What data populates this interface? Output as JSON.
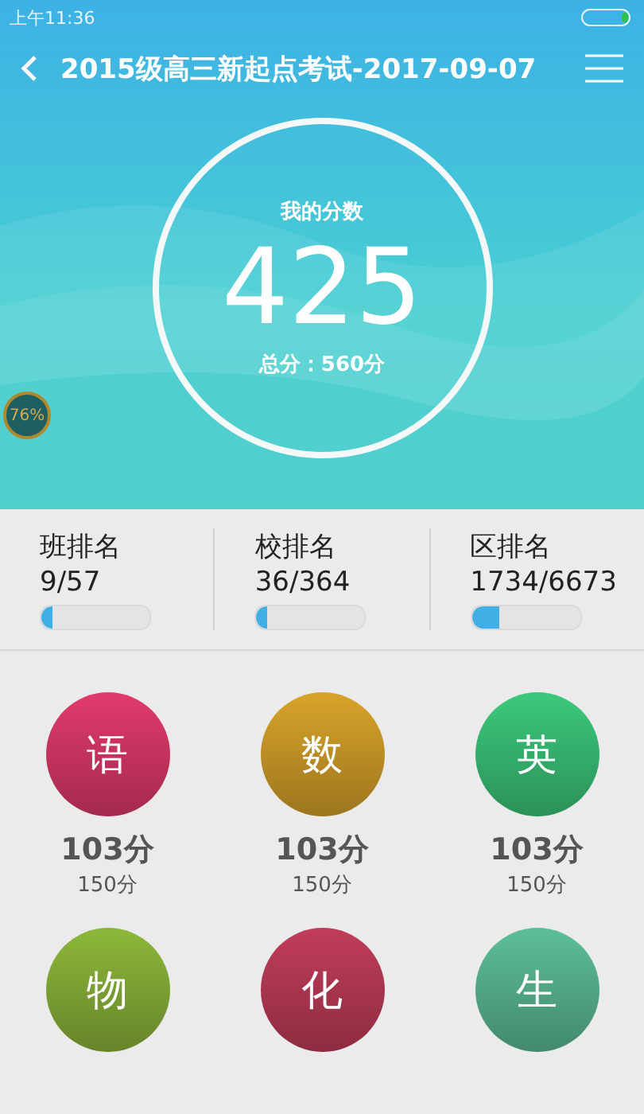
{
  "status_bar": {
    "time": "上午11:36"
  },
  "header": {
    "title": "2015级高三新起点考试-2017-09-07"
  },
  "score": {
    "label": "我的分数",
    "value": "425",
    "total": "总分：560分"
  },
  "badge": {
    "text": "76%"
  },
  "rankings": [
    {
      "label": "班排名",
      "value": "9/57",
      "level": 0.1
    },
    {
      "label": "校排名",
      "value": "36/364",
      "level": 0.1
    },
    {
      "label": "区排名",
      "value": "1734/6673",
      "level": 0.26
    }
  ],
  "subjects": [
    {
      "name": "语",
      "color": "#e23a6c",
      "score": "103分",
      "full": "150分"
    },
    {
      "name": "数",
      "color": "#d8a42a",
      "score": "103分",
      "full": "150分"
    },
    {
      "name": "英",
      "color": "#3cc97c",
      "score": "103分",
      "full": "150分"
    },
    {
      "name": "物",
      "color": "#8db83a"
    },
    {
      "name": "化",
      "color": "#c23d5a"
    },
    {
      "name": "生",
      "color": "#5dbf98"
    }
  ]
}
